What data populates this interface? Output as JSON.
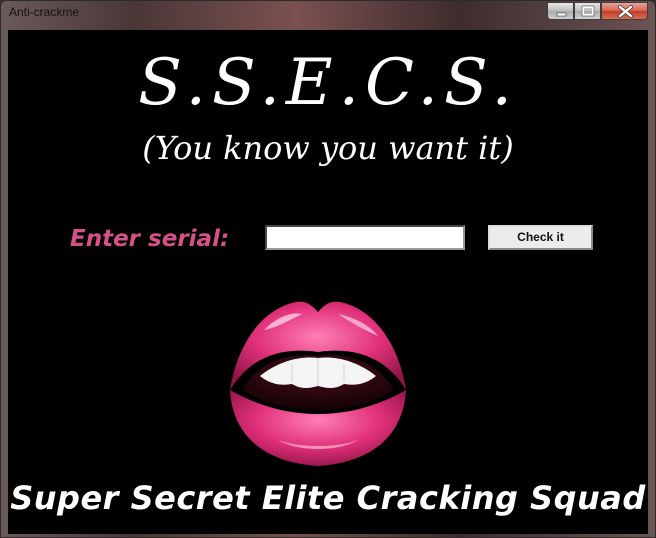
{
  "window": {
    "title": "Anti-crackme",
    "controls": {
      "minimize": "minimize-icon",
      "maximize": "maximize-icon",
      "close": "close-icon"
    }
  },
  "header": {
    "logo_text": "S.S.E.C.S.",
    "tagline": "(You know you want it)"
  },
  "serial": {
    "label": "Enter serial:",
    "value": "",
    "check_label": "Check it"
  },
  "image": {
    "icon": "lips-image"
  },
  "footer": {
    "squad_name": "Super Secret Elite Cracking Squad"
  },
  "colors": {
    "background": "#000000",
    "label_pink": "#d6508a",
    "lip_pink": "#e0307a"
  }
}
